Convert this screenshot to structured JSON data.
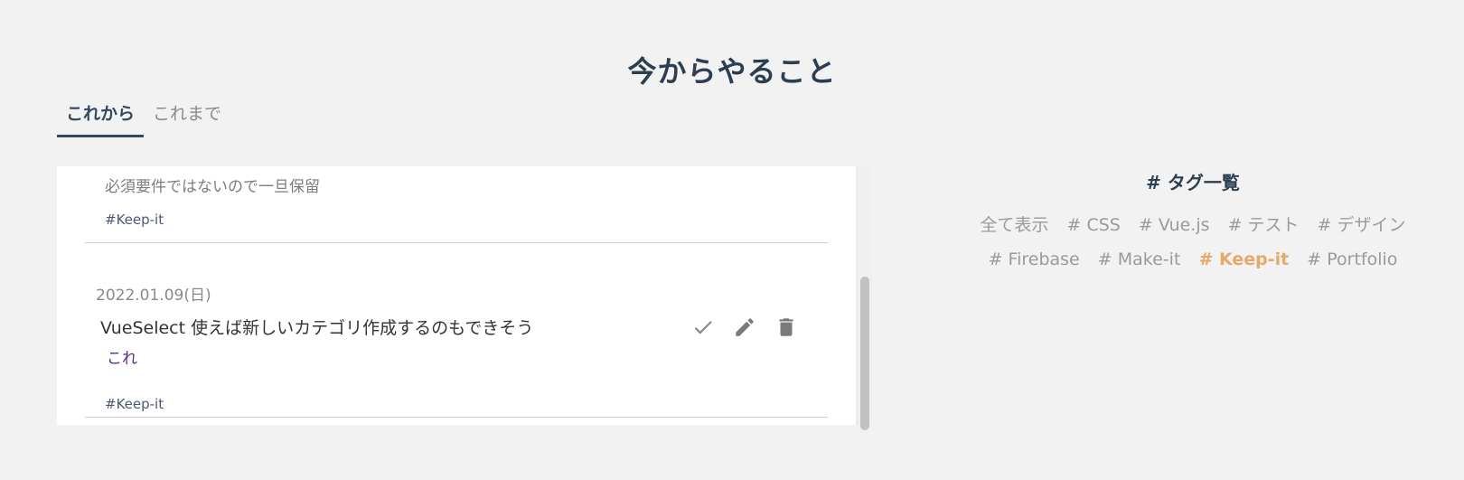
{
  "page": {
    "title": "今からやること"
  },
  "tabs": [
    {
      "label": "これから",
      "active": true
    },
    {
      "label": "これまで",
      "active": false
    }
  ],
  "todos": [
    {
      "memo": "必須要件ではないので一旦保留",
      "tag": "#Keep-it"
    },
    {
      "date": "2022.01.09(日)",
      "title": "VueSelect 使えば新しいカテゴリ作成するのもできそう",
      "link_text": "これ",
      "tag": "#Keep-it",
      "actions": [
        "check-icon",
        "pencil-icon",
        "trash-icon"
      ]
    }
  ],
  "tag_panel": {
    "heading": "# タグ一覧",
    "row1": [
      "全て表示",
      "# CSS",
      "# Vue.js",
      "# テスト",
      "# デザイン"
    ],
    "row2": [
      "# Firebase",
      "# Make-it",
      "# Keep-it",
      "# Portfolio"
    ],
    "active_tag": "# Keep-it"
  },
  "colors": {
    "background": "#f2f2f2",
    "text_primary": "#2c3e50",
    "active_tag": "#e8a86a",
    "link": "#5b2a86",
    "muted": "#9a9a9a"
  }
}
